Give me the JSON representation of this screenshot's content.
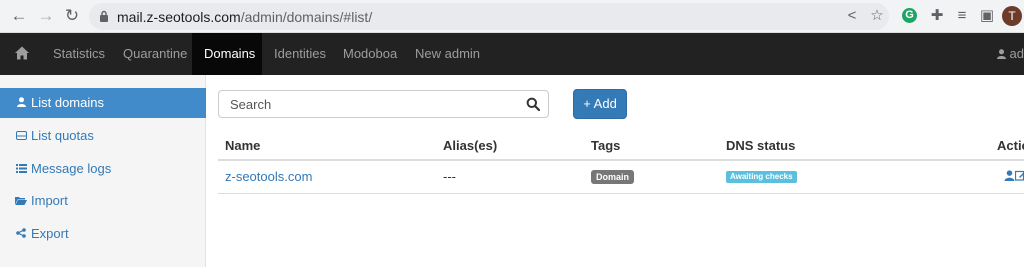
{
  "browser": {
    "url_host": "mail.z-seotools.com",
    "url_path": "/admin/domains/#list/",
    "profile_initial": "T",
    "extension_initial": "G"
  },
  "navbar": {
    "items": [
      {
        "label": "Statistics",
        "active": false
      },
      {
        "label": "Quarantine",
        "active": false
      },
      {
        "label": "Domains",
        "active": true
      },
      {
        "label": "Identities",
        "active": false
      },
      {
        "label": "Modoboa",
        "active": false
      },
      {
        "label": "New admin",
        "active": false
      }
    ],
    "user_label": "ad"
  },
  "sidebar": {
    "items": [
      {
        "label": "List domains",
        "icon": "user-icon",
        "active": true
      },
      {
        "label": "List quotas",
        "icon": "hdd-icon",
        "active": false
      },
      {
        "label": "Message logs",
        "icon": "list-icon",
        "active": false
      },
      {
        "label": "Import",
        "icon": "folder-open-icon",
        "active": false
      },
      {
        "label": "Export",
        "icon": "share-icon",
        "active": false
      }
    ]
  },
  "toolbar": {
    "search_placeholder": "Search",
    "add_label": "+ Add"
  },
  "table": {
    "headers": [
      "Name",
      "Alias(es)",
      "Tags",
      "DNS status",
      "Actio"
    ],
    "rows": [
      {
        "name": "z-seotools.com",
        "aliases": "---",
        "tag": "Domain",
        "dns_status": "Awaiting checks",
        "actions": [
          "user-icon",
          "edit-icon"
        ]
      }
    ]
  },
  "colors": {
    "navbar_bg": "#222222",
    "active_blue": "#428bca",
    "link_blue": "#337ab7",
    "tag_gray": "#777777",
    "tag_info": "#5bc0de"
  }
}
